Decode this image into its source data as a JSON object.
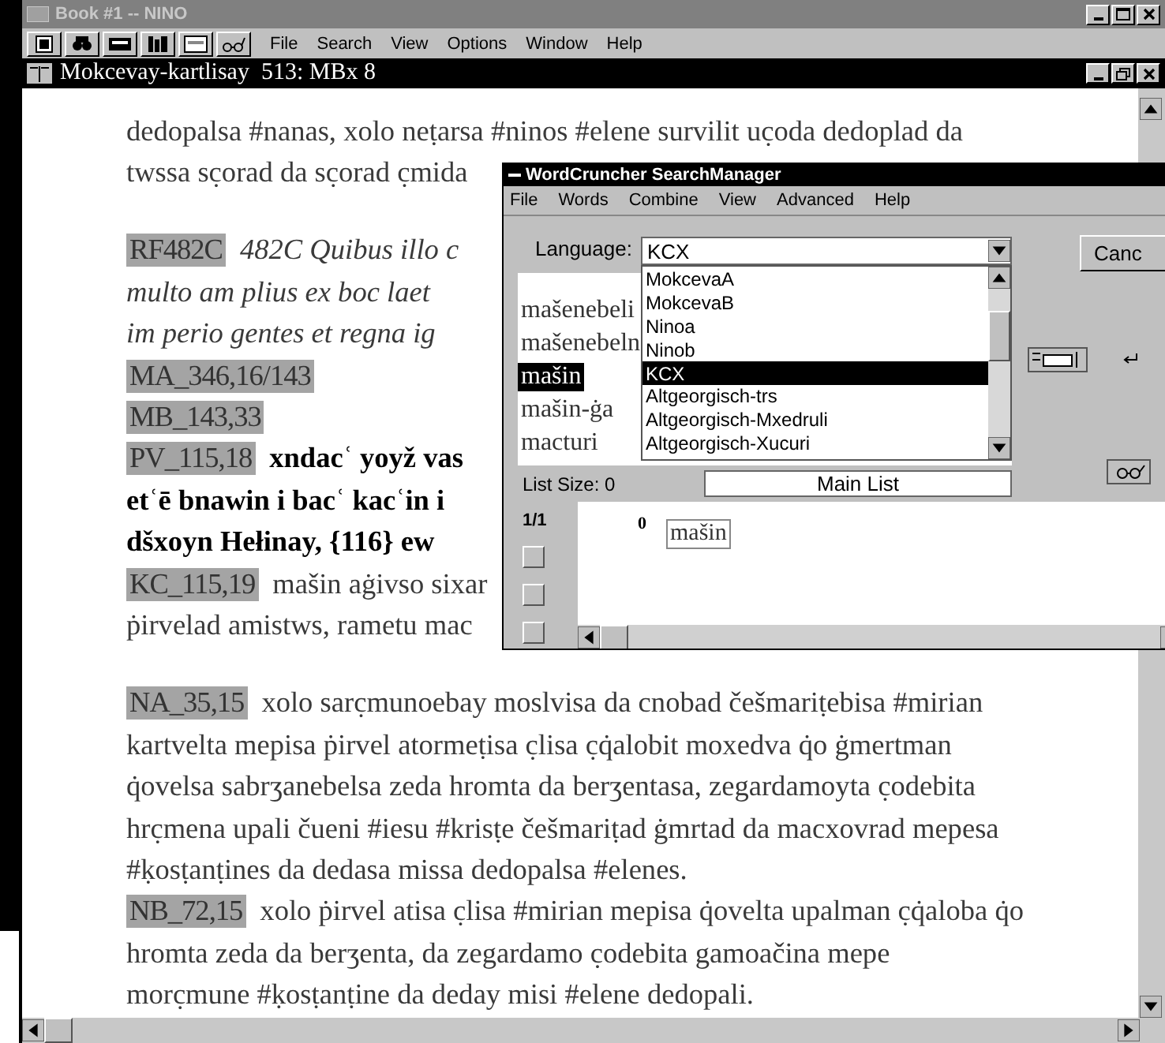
{
  "app_window": {
    "title": "Book #1 -- NINO",
    "menu": [
      "File",
      "Search",
      "View",
      "Options",
      "Window",
      "Help"
    ]
  },
  "document_window": {
    "title": "Mokcevay-kartlisay  513: MBx 8",
    "lines": [
      {
        "kind": "georgian",
        "text": "dedopalsa #nanas, xolo neṭarsa #ninos #elene survilit uc̣oda dedoplad da"
      },
      {
        "kind": "georgian",
        "text": "twssa sc̣orad da sc̣orad c̣mida"
      },
      {
        "kind": "gap"
      },
      {
        "kind": "latin",
        "ref": "RF482C",
        "text": "482C Quibus illo c"
      },
      {
        "kind": "latin",
        "text": "multo am plius ex boc laet"
      },
      {
        "kind": "latin",
        "text": "im perio gentes et regna ig"
      },
      {
        "kind": "georgian",
        "ref": "MA_346,16/143"
      },
      {
        "kind": "georgian",
        "ref": "MB_143,33"
      },
      {
        "kind": "armenian",
        "ref": "PV_115,18",
        "text": "xndacʿ yoyž vas"
      },
      {
        "kind": "armenian",
        "text": "etʿē bnawin i bacʿ kacʿin i"
      },
      {
        "kind": "armenian",
        "text": "dšxoyn Hełinay, {116} ew"
      },
      {
        "kind": "georgian",
        "ref": "KC_115,19",
        "text": "mašin aġivso sixar"
      },
      {
        "kind": "georgian",
        "text": "ṗirvelad amistws, rametu mac"
      },
      {
        "kind": "gap"
      },
      {
        "kind": "georgian",
        "ref": "NA_35,15",
        "text": "xolo sarc̣munoebay moslvisa da cnobad češmariṭebisa #mirian"
      },
      {
        "kind": "georgian",
        "text": "kartvelta mepisa ṗirvel atormeṭisa c̣lisa c̣q̇alobit moxedva q̇o ġmertman"
      },
      {
        "kind": "georgian",
        "text": "q̇ovelsa sabrʒanebelsa zeda hromta da berʒentasa, zegardamoyta c̣odebita"
      },
      {
        "kind": "georgian",
        "text": "hrc̣mena upali čueni #iesu #krisṭe češmariṭad ġmrtad da macxovrad mepesa"
      },
      {
        "kind": "georgian",
        "text": "#ḳosṭanṭines da dedasa missa dedopalsa #elenes."
      },
      {
        "kind": "georgian",
        "ref": "NB_72,15",
        "text": "xolo ṗirvel atisa c̣lisa #mirian mepisa q̇ovelta upalman c̣q̇aloba q̇o"
      },
      {
        "kind": "georgian",
        "text": "hromta zeda da berʒenta, da zegardamo c̣odebita gamoačina mepe"
      },
      {
        "kind": "georgian",
        "text": "morc̣mune #ḳosṭanṭine da deday misi #elene dedopali."
      }
    ]
  },
  "search_manager": {
    "title": "WordCruncher SearchManager",
    "menu": [
      "File",
      "Words",
      "Combine",
      "View",
      "Advanced",
      "Help"
    ],
    "language_label": "Language:",
    "language_value": "KCX",
    "cancel_button": "Canc",
    "language_options": [
      {
        "label": "MokcevaA",
        "selected": false
      },
      {
        "label": "MokcevaB",
        "selected": false
      },
      {
        "label": "Ninoa",
        "selected": false
      },
      {
        "label": "Ninob",
        "selected": false
      },
      {
        "label": "KCX",
        "selected": true
      },
      {
        "label": "Altgeorgisch-trs",
        "selected": false
      },
      {
        "label": "Altgeorgisch-Mxedruli",
        "selected": false
      },
      {
        "label": "Altgeorgisch-Xucuri",
        "selected": false
      }
    ],
    "words": [
      {
        "text": "mašenebeli",
        "selected": false
      },
      {
        "text": "mašenebeln",
        "selected": false
      },
      {
        "text": "mašin",
        "selected": true
      },
      {
        "text": "mašin-ġa",
        "selected": false
      },
      {
        "text": "macturi",
        "selected": false
      }
    ],
    "list_size": "List Size: 0",
    "list_name": "Main List",
    "page": "1/1",
    "count": "0",
    "hit_word": "mašin"
  }
}
